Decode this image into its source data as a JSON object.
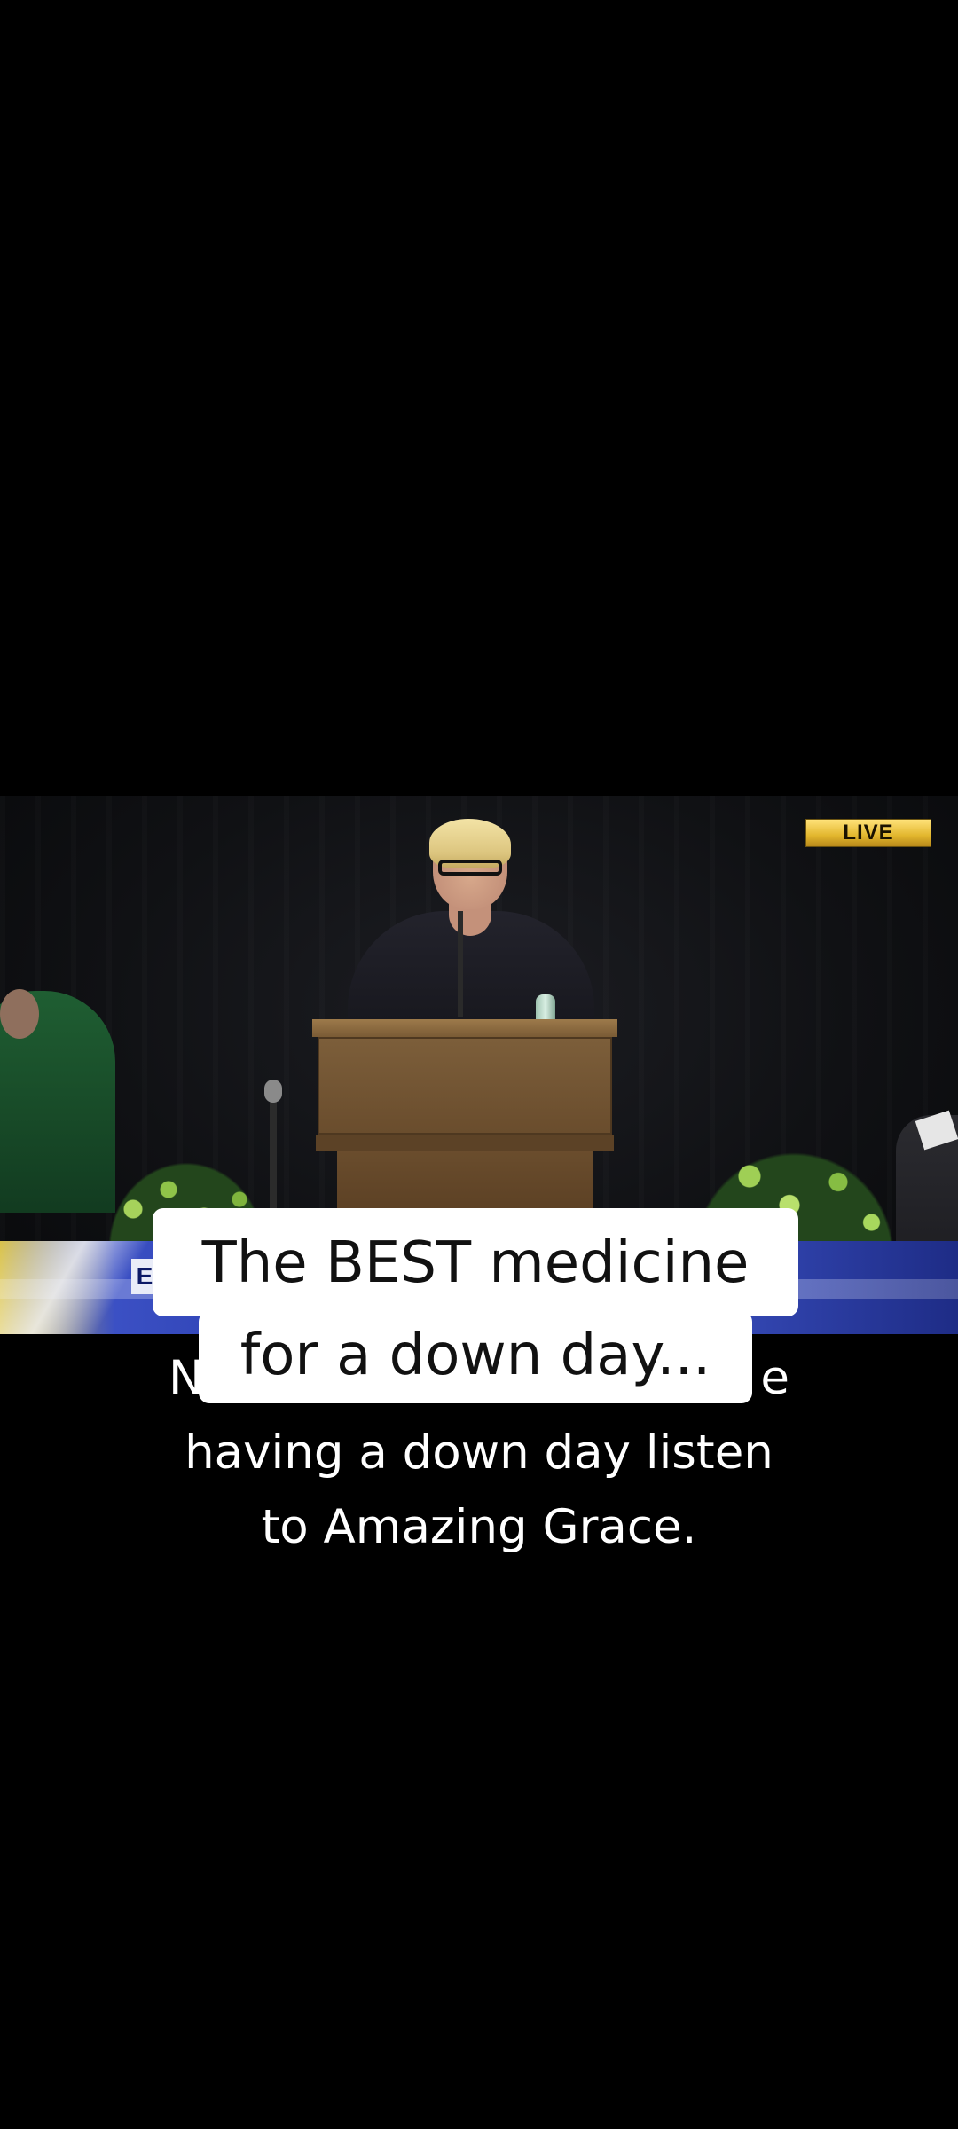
{
  "video": {
    "live_badge": "LIVE",
    "lower_third_initial": "E"
  },
  "captions": {
    "line1_visible": "N",
    "line1_end": "e",
    "line2": "having a down day listen",
    "line3": "to Amazing Grace."
  },
  "title_sticker": {
    "line1": "The BEST medicine",
    "line2": "for a down day..."
  }
}
